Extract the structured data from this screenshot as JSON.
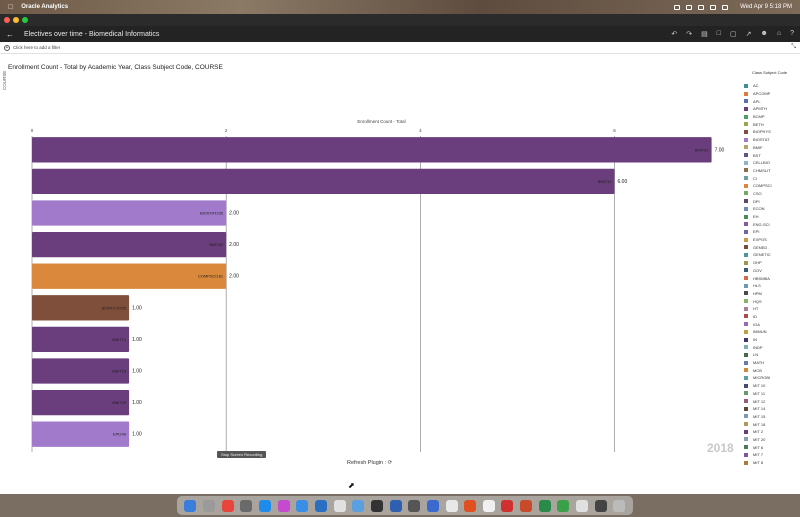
{
  "menubar": {
    "app_name": "Oracle Analytics",
    "clock": "Wed Apr 9  5:18 PM"
  },
  "appbar": {
    "title": "Electives over time - Biomedical Informatics",
    "tools": [
      "undo-icon",
      "redo-icon",
      "save-icon",
      "present-icon",
      "share-icon",
      "export-icon",
      "person-icon",
      "home-icon",
      "help-icon"
    ]
  },
  "filterbar": {
    "placeholder": "Click here to add a filter"
  },
  "canvas": {
    "year_label": "2018",
    "stop_recording_label": "Stop Screen Recording",
    "refresh_label": "Refresh Plugin :"
  },
  "chart_data": {
    "type": "bar",
    "orientation": "horizontal",
    "title": "Enrollment Count - Total by Academic Year, Class Subject Code, COURSE",
    "xlabel": "Enrollment Count - Total",
    "ylabel": "COURSE",
    "xlim": [
      0,
      7.2
    ],
    "xticks": [
      0,
      2,
      4,
      6
    ],
    "grid": true,
    "legend_title": "Class Subject Code",
    "legend_position": "right",
    "bars": [
      {
        "label": "BMI701",
        "value": 7.0,
        "value_label": "7.00",
        "color": "#6a3d7c"
      },
      {
        "label": "BMI714",
        "value": 6.0,
        "value_label": "6.00",
        "color": "#6a3d7c"
      },
      {
        "label": "BIOSTAT230",
        "value": 2.0,
        "value_label": "2.00",
        "color": "#a27acb"
      },
      {
        "label": "BMI702",
        "value": 2.0,
        "value_label": "2.00",
        "color": "#6a3d7c"
      },
      {
        "label": "COMPSCI181",
        "value": 2.0,
        "value_label": "2.00",
        "color": "#d9883c"
      },
      {
        "label": "BIOPHYS205",
        "value": 1.0,
        "value_label": "1.00",
        "color": "#7f4f3c"
      },
      {
        "label": "BMI713",
        "value": 1.0,
        "value_label": "1.00",
        "color": "#6a3d7c"
      },
      {
        "label": "BMI715",
        "value": 1.0,
        "value_label": "1.00",
        "color": "#6a3d7c"
      },
      {
        "label": "BMI720",
        "value": 1.0,
        "value_label": "1.00",
        "color": "#6a3d7c"
      },
      {
        "label": "EPI249",
        "value": 1.0,
        "value_label": "1.00",
        "color": "#a27acb"
      }
    ],
    "legend": [
      {
        "name": "AC",
        "color": "#3f8f8f"
      },
      {
        "name": "APCOMP",
        "color": "#e07b39"
      },
      {
        "name": "APL",
        "color": "#5b6fae"
      },
      {
        "name": "APMTH",
        "color": "#6a3d7c"
      },
      {
        "name": "BCMP",
        "color": "#4f9f6a"
      },
      {
        "name": "BETH",
        "color": "#9aa64a"
      },
      {
        "name": "BIOPHYS",
        "color": "#7f4f3c"
      },
      {
        "name": "BIOSTAT",
        "color": "#a27acb"
      },
      {
        "name": "BMIF",
        "color": "#b4a46a"
      },
      {
        "name": "BST",
        "color": "#5a5a8a"
      },
      {
        "name": "CELLBIO",
        "color": "#8fb6c8"
      },
      {
        "name": "CHMSLIT",
        "color": "#8a6f4a"
      },
      {
        "name": "CI",
        "color": "#6aa0a0"
      },
      {
        "name": "COMPSCI",
        "color": "#d9883c"
      },
      {
        "name": "CSO",
        "color": "#7aa66a"
      },
      {
        "name": "DPI",
        "color": "#5a4a6a"
      },
      {
        "name": "ECON",
        "color": "#6a8fb0"
      },
      {
        "name": "EH",
        "color": "#4a8a5a"
      },
      {
        "name": "ENG-SCI",
        "color": "#8a5a9a"
      },
      {
        "name": "EPI",
        "color": "#6a6aa0"
      },
      {
        "name": "EXPOS",
        "color": "#c89a4a"
      },
      {
        "name": "GENED",
        "color": "#7a4a3a"
      },
      {
        "name": "GENETIC",
        "color": "#4a9a9a"
      },
      {
        "name": "GHP",
        "color": "#9a9a4a"
      },
      {
        "name": "GOV",
        "color": "#3a5a7a"
      },
      {
        "name": "HBSMBA",
        "color": "#d06a4a"
      },
      {
        "name": "HLS",
        "color": "#6a9ab0"
      },
      {
        "name": "HPM",
        "color": "#4a4a4a"
      },
      {
        "name": "HQS",
        "color": "#8ab06a"
      },
      {
        "name": "HT",
        "color": "#b07a9a"
      },
      {
        "name": "ID",
        "color": "#b04a4a"
      },
      {
        "name": "IGA",
        "color": "#9a6ab0"
      },
      {
        "name": "IMMUN",
        "color": "#c0a040"
      },
      {
        "name": "IN",
        "color": "#3a3a6a"
      },
      {
        "name": "INDP",
        "color": "#7ab0b0"
      },
      {
        "name": "LN",
        "color": "#4a6a4a"
      },
      {
        "name": "MATH",
        "color": "#6a7ab0"
      },
      {
        "name": "MCB",
        "color": "#d08a3a"
      },
      {
        "name": "MICROBI",
        "color": "#5aa0a0"
      },
      {
        "name": "MIT 10",
        "color": "#4a4a6a"
      },
      {
        "name": "MIT 11",
        "color": "#6a9a6a"
      },
      {
        "name": "MIT 12",
        "color": "#9a5a7a"
      },
      {
        "name": "MIT 14",
        "color": "#5a4a3a"
      },
      {
        "name": "MIT 15",
        "color": "#7a9ab0"
      },
      {
        "name": "MIT 18",
        "color": "#b09a5a"
      },
      {
        "name": "MIT 2",
        "color": "#6a3d7c"
      },
      {
        "name": "MIT 20",
        "color": "#8aa0b0"
      },
      {
        "name": "MIT 6",
        "color": "#4a7a5a"
      },
      {
        "name": "MIT 7",
        "color": "#7a5a9a"
      },
      {
        "name": "MIT 8",
        "color": "#b07a3a"
      }
    ]
  }
}
